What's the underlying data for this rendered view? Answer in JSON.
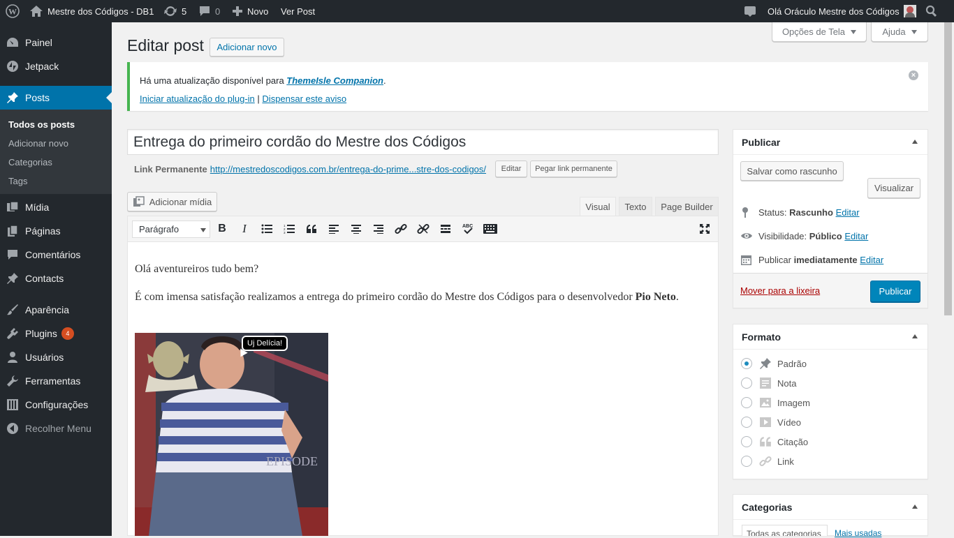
{
  "adminbar": {
    "site_name": "Mestre dos Códigos - DB1",
    "updates_count": "5",
    "comments_count": "0",
    "new_label": "Novo",
    "view_post_label": "Ver Post",
    "greeting": "Olá Oráculo Mestre dos Códigos"
  },
  "sidebar": {
    "items": [
      {
        "label": "Painel",
        "icon": "dashboard-icon"
      },
      {
        "label": "Jetpack",
        "icon": "jetpack-icon"
      },
      {
        "label": "Posts",
        "icon": "pin-icon"
      },
      {
        "label": "Mídia",
        "icon": "media-icon"
      },
      {
        "label": "Páginas",
        "icon": "pages-icon"
      },
      {
        "label": "Comentários",
        "icon": "comments-icon"
      },
      {
        "label": "Contacts",
        "icon": "pin-icon"
      },
      {
        "label": "Aparência",
        "icon": "brush-icon"
      },
      {
        "label": "Plugins",
        "icon": "plugins-icon",
        "badge": "4"
      },
      {
        "label": "Usuários",
        "icon": "users-icon"
      },
      {
        "label": "Ferramentas",
        "icon": "tools-icon"
      },
      {
        "label": "Configurações",
        "icon": "settings-icon"
      },
      {
        "label": "Recolher Menu",
        "icon": "collapse-icon"
      }
    ],
    "posts_submenu": [
      "Todos os posts",
      "Adicionar novo",
      "Categorias",
      "Tags"
    ]
  },
  "screen_options": {
    "options_label": "Opções de Tela",
    "help_label": "Ajuda"
  },
  "page": {
    "title": "Editar post",
    "add_new_label": "Adicionar novo"
  },
  "notice": {
    "text_before": "Há uma atualização disponível para ",
    "plugin_name": "ThemeIsle Companion",
    "text_after": ".",
    "update_link": "Iniciar atualização do plug-in",
    "separator": "|",
    "dismiss_link": "Dispensar este aviso"
  },
  "post": {
    "title": "Entrega do primeiro cordão do Mestre dos Códigos",
    "permalink_label": "Link Permanente",
    "permalink_base": "http://mestredoscodigos.com.br/",
    "permalink_slug": "entrega-do-prime...stre-dos-codigos/",
    "edit_permalink_label": "Editar",
    "get_shortlink_label": "Pegar link permanente"
  },
  "editor": {
    "add_media_label": "Adicionar mídia",
    "tabs": [
      "Visual",
      "Texto",
      "Page Builder"
    ],
    "format_select": "Parágrafo",
    "paragraph1": "Olá aventureiros tudo bem?",
    "paragraph2_text": "É com imensa satisfação realizamos a entrega do primeiro cordão do Mestre dos Códigos para o desenvolvedor ",
    "paragraph2_bold": "Pio Neto",
    "paragraph2_end": ".",
    "image_speech": "Uj Delícia!",
    "image_poster_text": "EPISODE"
  },
  "publish_box": {
    "title": "Publicar",
    "save_draft_label": "Salvar como rascunho",
    "preview_label": "Visualizar",
    "status_label": "Status:",
    "status_value": "Rascunho",
    "visibility_label": "Visibilidade:",
    "visibility_value": "Público",
    "publish_label": "Publicar",
    "publish_when": "imediatamente",
    "edit_label": "Editar",
    "trash_label": "Mover para a lixeira",
    "publish_button": "Publicar"
  },
  "format_box": {
    "title": "Formato",
    "options": [
      {
        "label": "Padrão",
        "icon": "pin-icon",
        "checked": true
      },
      {
        "label": "Nota",
        "icon": "note-icon",
        "checked": false
      },
      {
        "label": "Imagem",
        "icon": "image-icon",
        "checked": false
      },
      {
        "label": "Vídeo",
        "icon": "video-icon",
        "checked": false
      },
      {
        "label": "Citação",
        "icon": "quote-icon",
        "checked": false
      },
      {
        "label": "Link",
        "icon": "link-icon",
        "checked": false
      }
    ]
  },
  "categories_box": {
    "title": "Categorias",
    "tab_all": "Todas as categorias",
    "tab_popular": "Mais usadas"
  },
  "colors": {
    "admin_bar": "#23282d",
    "sidebar_active": "#0073aa",
    "primary_button": "#0085ba",
    "notice_border": "#46b450",
    "trash_link": "#a00"
  }
}
